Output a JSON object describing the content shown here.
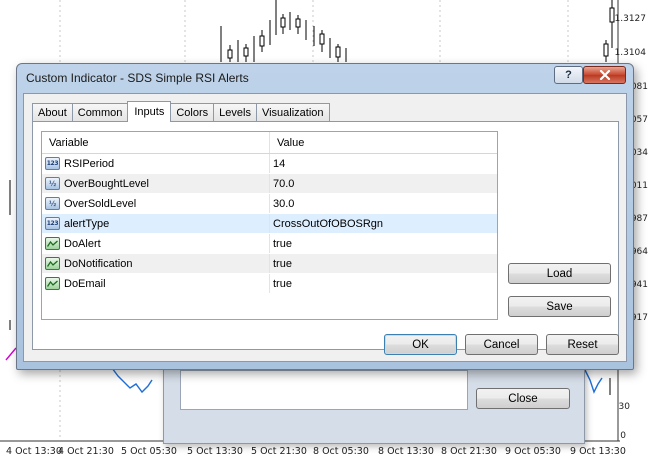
{
  "dialog": {
    "title": "Custom Indicator - SDS Simple RSI Alerts",
    "help_label": "?",
    "tabs": [
      {
        "label": "About"
      },
      {
        "label": "Common"
      },
      {
        "label": "Inputs",
        "active": true
      },
      {
        "label": "Colors"
      },
      {
        "label": "Levels"
      },
      {
        "label": "Visualization"
      }
    ],
    "grid": {
      "header": {
        "variable": "Variable",
        "value": "Value"
      },
      "rows": [
        {
          "type_icon": "123",
          "icon_name": "integer-icon",
          "variable": "RSIPeriod",
          "value": "14"
        },
        {
          "type_icon": "½",
          "icon_name": "double-icon",
          "variable": "OverBoughtLevel",
          "value": "70.0"
        },
        {
          "type_icon": "½",
          "icon_name": "double-icon",
          "variable": "OverSoldLevel",
          "value": "30.0"
        },
        {
          "type_icon": "123",
          "icon_name": "integer-icon",
          "variable": "alertType",
          "value": "CrossOutOfOBOSRgn"
        },
        {
          "type_icon": "~",
          "icon_name": "bool-icon",
          "variable": "DoAlert",
          "value": "true"
        },
        {
          "type_icon": "~",
          "icon_name": "bool-icon",
          "variable": "DoNotification",
          "value": "true"
        },
        {
          "type_icon": "~",
          "icon_name": "bool-icon",
          "variable": "DoEmail",
          "value": "true"
        }
      ]
    },
    "buttons": {
      "load": "Load",
      "save": "Save",
      "ok": "OK",
      "cancel": "Cancel",
      "reset": "Reset"
    }
  },
  "back_dialog": {
    "close_label": "Close"
  },
  "chart": {
    "price_labels": [
      "1.3127",
      "1.3104",
      "081",
      "057",
      "034",
      "011",
      "987",
      "964",
      "941",
      "917",
      "30",
      "0"
    ],
    "time_labels": [
      "4 Oct 13:30",
      "4 Oct 21:30",
      "5 Oct 05:30",
      "5 Oct 13:30",
      "5 Oct 21:30",
      "8 Oct 05:30",
      "8 Oct 13:30",
      "8 Oct 21:30",
      "9 Oct 05:30",
      "9 Oct 13:30"
    ],
    "colors": {
      "candles": "#000000",
      "rsi_line": "#1e6fd9",
      "level_line": "#d400d4",
      "grid": "#c8c8c8"
    }
  }
}
